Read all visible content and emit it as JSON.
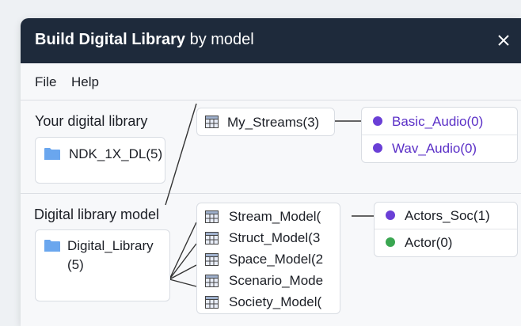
{
  "window": {
    "title_strong": "Build Digital Library",
    "title_rest": " by model"
  },
  "menu": {
    "file": "File",
    "help": "Help"
  },
  "library": {
    "heading": "Your digital library",
    "item": "NDK_1X_DL(5)",
    "stream": "My_Streams(3)",
    "audio": [
      "Basic_Audio(0)",
      "Wav_Audio(0)"
    ]
  },
  "model": {
    "heading": "Digital library model",
    "item_line1": "Digital_Library",
    "item_line2": "(5)",
    "models": [
      "Stream_Model(",
      "Struct_Model(3",
      "Space_Model(2",
      "Scenario_Mode",
      "Society_Model("
    ],
    "actors": [
      "Actors_Soc(1)",
      "Actor(0)"
    ]
  },
  "colors": {
    "titlebar": "#1e2a3b",
    "purple_dot": "#6a3fd6",
    "green_dot": "#3aa651",
    "folder": "#6aa6ee",
    "link_text": "#5b30c7"
  },
  "icons": [
    "close-icon",
    "folder-icon",
    "table-icon"
  ]
}
